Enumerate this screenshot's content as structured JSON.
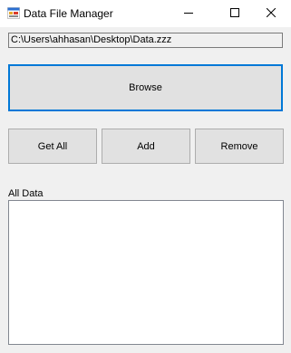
{
  "window": {
    "title": "Data File Manager",
    "icon": "app-window-icon",
    "controls": {
      "minimize_icon": "minimize-icon",
      "maximize_icon": "maximize-icon",
      "close_icon": "close-icon"
    }
  },
  "file_path": {
    "value": "C:\\Users\\ahhasan\\Desktop\\Data.zzz"
  },
  "buttons": {
    "browse": "Browse",
    "get_all": "Get All",
    "add": "Add",
    "remove": "Remove"
  },
  "list": {
    "label": "All Data",
    "items": []
  },
  "colors": {
    "focus_border": "#0078d7",
    "button_face": "#e1e1e1",
    "window_bg": "#f0f0f0"
  }
}
